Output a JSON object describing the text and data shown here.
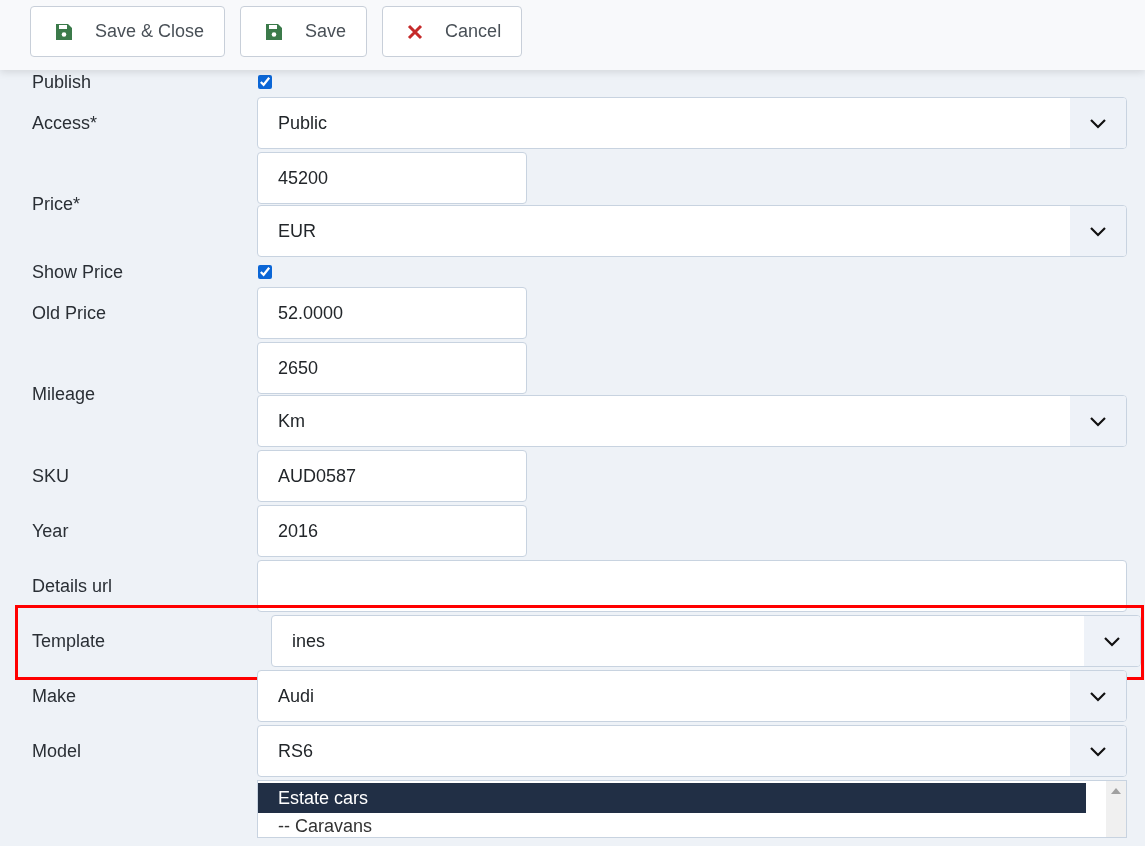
{
  "toolbar": {
    "buttons": [
      {
        "label": "Save & Close",
        "kind": "save"
      },
      {
        "label": "Save",
        "kind": "save"
      },
      {
        "label": "Cancel",
        "kind": "cancel"
      }
    ]
  },
  "form": {
    "rows": [
      {
        "label": "Publish",
        "highlighted": false,
        "controls": [
          {
            "kind": "checkbox",
            "checked": true
          }
        ]
      },
      {
        "label": "Access*",
        "highlighted": false,
        "controls": [
          {
            "kind": "select",
            "value": "Public"
          }
        ]
      },
      {
        "label": "Price*",
        "highlighted": false,
        "controls": [
          {
            "kind": "input",
            "value": "45200"
          },
          {
            "kind": "select",
            "value": "EUR"
          }
        ]
      },
      {
        "label": "Show Price",
        "highlighted": false,
        "controls": [
          {
            "kind": "checkbox",
            "checked": true
          }
        ]
      },
      {
        "label": "Old Price",
        "highlighted": false,
        "controls": [
          {
            "kind": "input",
            "value": "52.0000"
          }
        ]
      },
      {
        "label": "Mileage",
        "highlighted": false,
        "controls": [
          {
            "kind": "input",
            "value": "2650"
          },
          {
            "kind": "select",
            "value": "Km"
          }
        ]
      },
      {
        "label": "SKU",
        "highlighted": false,
        "controls": [
          {
            "kind": "input",
            "value": "AUD0587"
          }
        ]
      },
      {
        "label": "Year",
        "highlighted": false,
        "controls": [
          {
            "kind": "input",
            "value": "2016"
          }
        ]
      },
      {
        "label": "Details url",
        "highlighted": false,
        "controls": [
          {
            "kind": "wideinput"
          }
        ]
      },
      {
        "label": "Template",
        "highlighted": true,
        "controls": [
          {
            "kind": "select",
            "value": "ines"
          }
        ]
      },
      {
        "label": "Make",
        "highlighted": false,
        "controls": [
          {
            "kind": "select",
            "value": "Audi"
          }
        ]
      },
      {
        "label": "Model",
        "highlighted": false,
        "controls": [
          {
            "kind": "select",
            "value": "RS6"
          }
        ]
      },
      {
        "label": "",
        "highlighted": false,
        "controls": [
          {
            "kind": "listbox",
            "options": [
              {
                "label": "Estate cars",
                "selected": true
              },
              {
                "label": "-- Caravans",
                "selected": false
              }
            ]
          }
        ]
      }
    ]
  }
}
